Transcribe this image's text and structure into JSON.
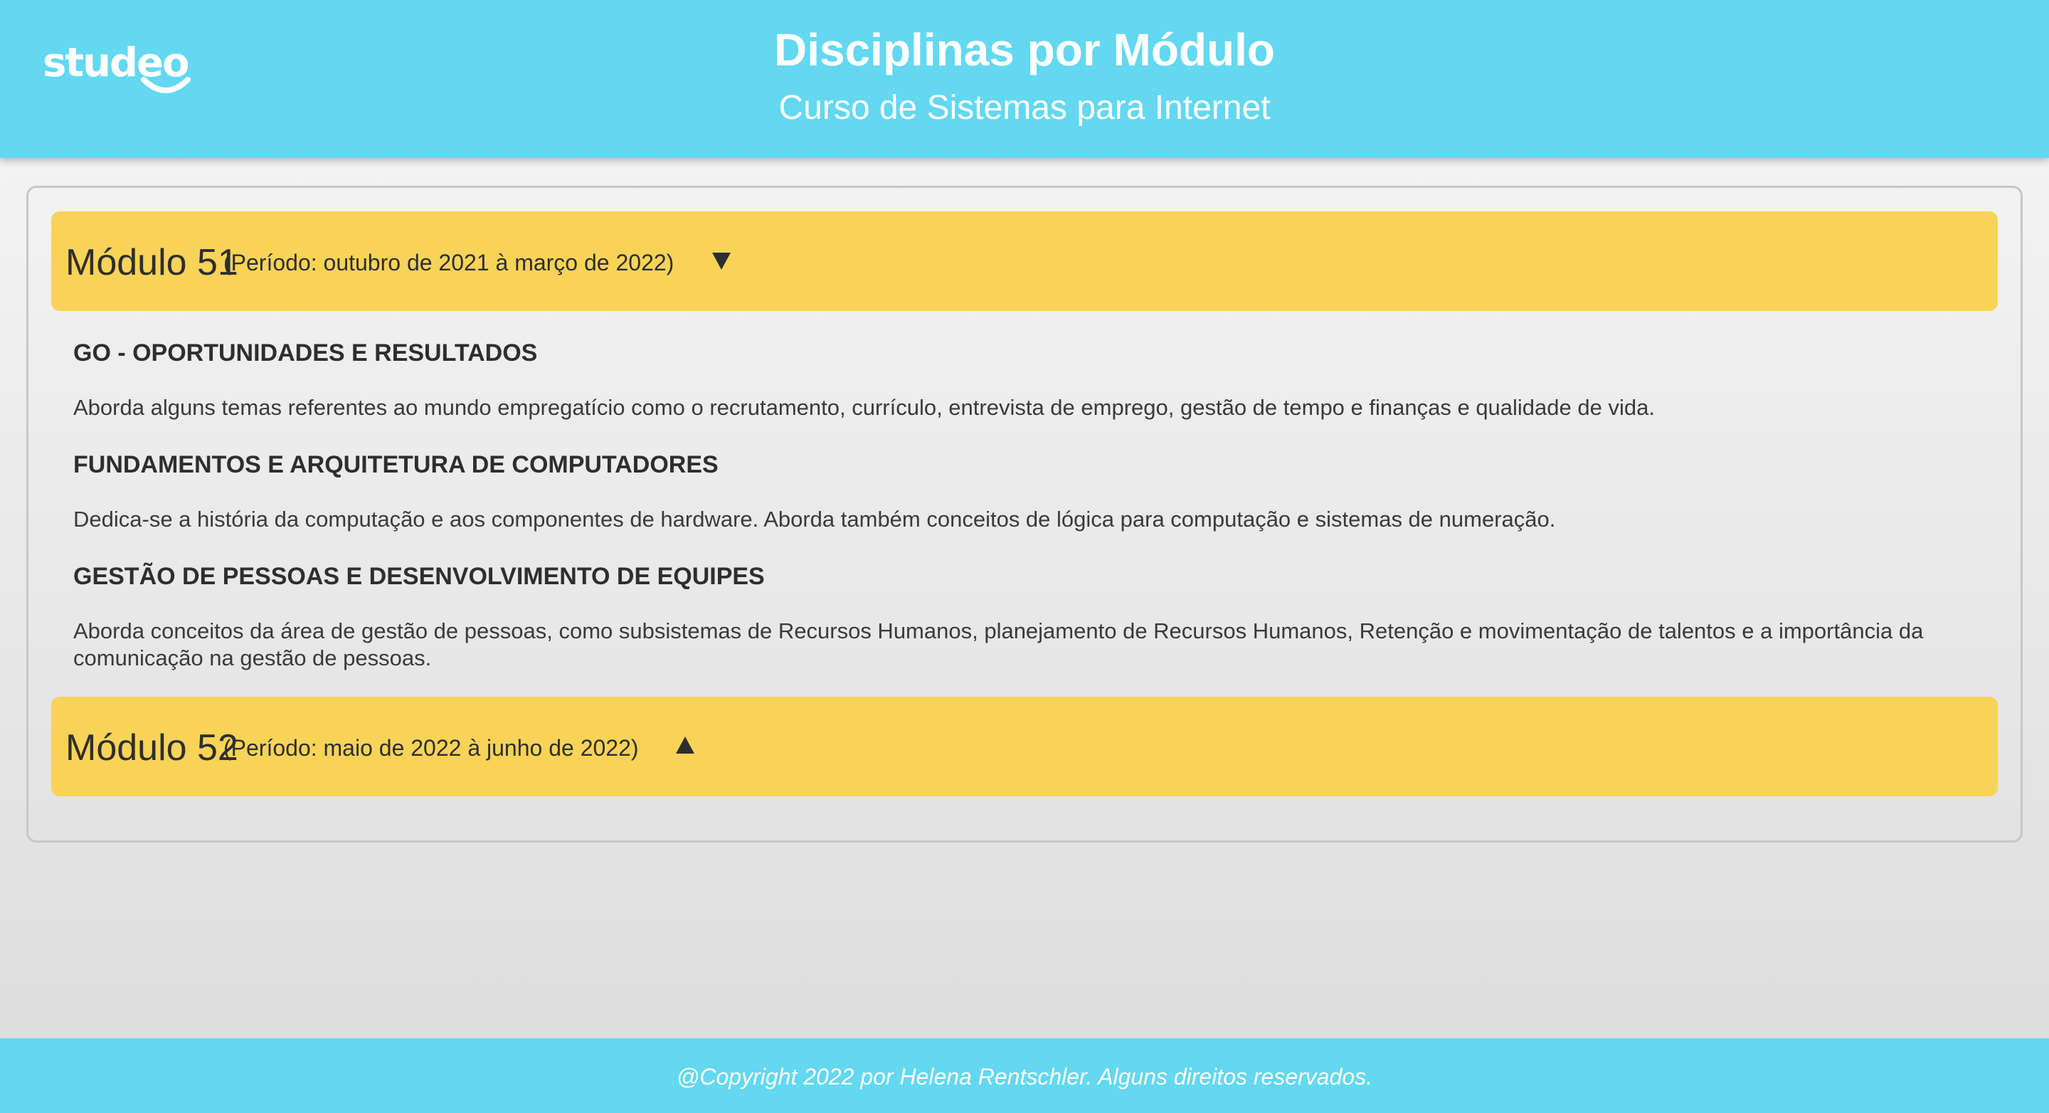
{
  "header": {
    "logo_text": "studeo",
    "title": "Disciplinas por Módulo",
    "subtitle": "Curso de Sistemas para Internet"
  },
  "modules": [
    {
      "title": "Módulo 51",
      "period": "(Período: outubro de 2021 à março de 2022)",
      "arrow": "caret-down-icon",
      "expanded": true,
      "subjects": [
        {
          "name": "GO - OPORTUNIDADES E RESULTADOS",
          "description": "Aborda alguns temas referentes ao mundo empregatício como o recrutamento, currículo, entrevista de emprego, gestão de tempo e finanças e qualidade de vida."
        },
        {
          "name": "FUNDAMENTOS E ARQUITETURA DE COMPUTADORES",
          "description": "Dedica-se a história da computação e aos componentes de hardware. Aborda também conceitos de lógica para computação e sistemas de numeração."
        },
        {
          "name": "GESTÃO DE PESSOAS E DESENVOLVIMENTO DE EQUIPES",
          "description": "Aborda conceitos da área de gestão de pessoas, como subsistemas de Recursos Humanos, planejamento de Recursos Humanos, Retenção e movimentação de talentos e a importância da comunicação na gestão de pessoas."
        }
      ]
    },
    {
      "title": "Módulo 52",
      "period": "(Período: maio de 2022 à junho de 2022)",
      "arrow": "caret-up-icon",
      "expanded": false,
      "subjects": []
    }
  ],
  "footer": {
    "text": "@Copyright 2022 por Helena Rentschler. Alguns direitos reservados."
  },
  "colors": {
    "header_bg": "#63d8f0",
    "module_bg": "#f8d358",
    "text": "#2e2e2e"
  }
}
